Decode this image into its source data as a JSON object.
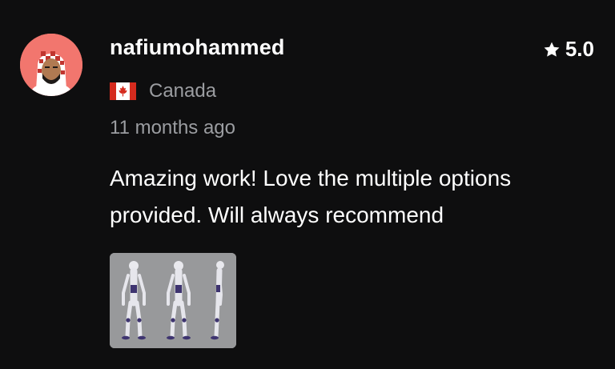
{
  "review": {
    "username": "nafiumohammed",
    "rating": "5.0",
    "country": "Canada",
    "time_ago": "11 months ago",
    "text": "Amazing work! Love the multiple options provided. Will always recommend",
    "icons": {
      "avatar": "user-avatar",
      "rating": "star-icon",
      "country": "canada-flag-icon"
    },
    "attachment_alt": "character turnaround sheet thumbnail"
  },
  "colors": {
    "background": "#0e0e0f",
    "primary_text": "#ffffff",
    "secondary_text": "#9b9da1",
    "avatar_bg": "#f2766e"
  }
}
